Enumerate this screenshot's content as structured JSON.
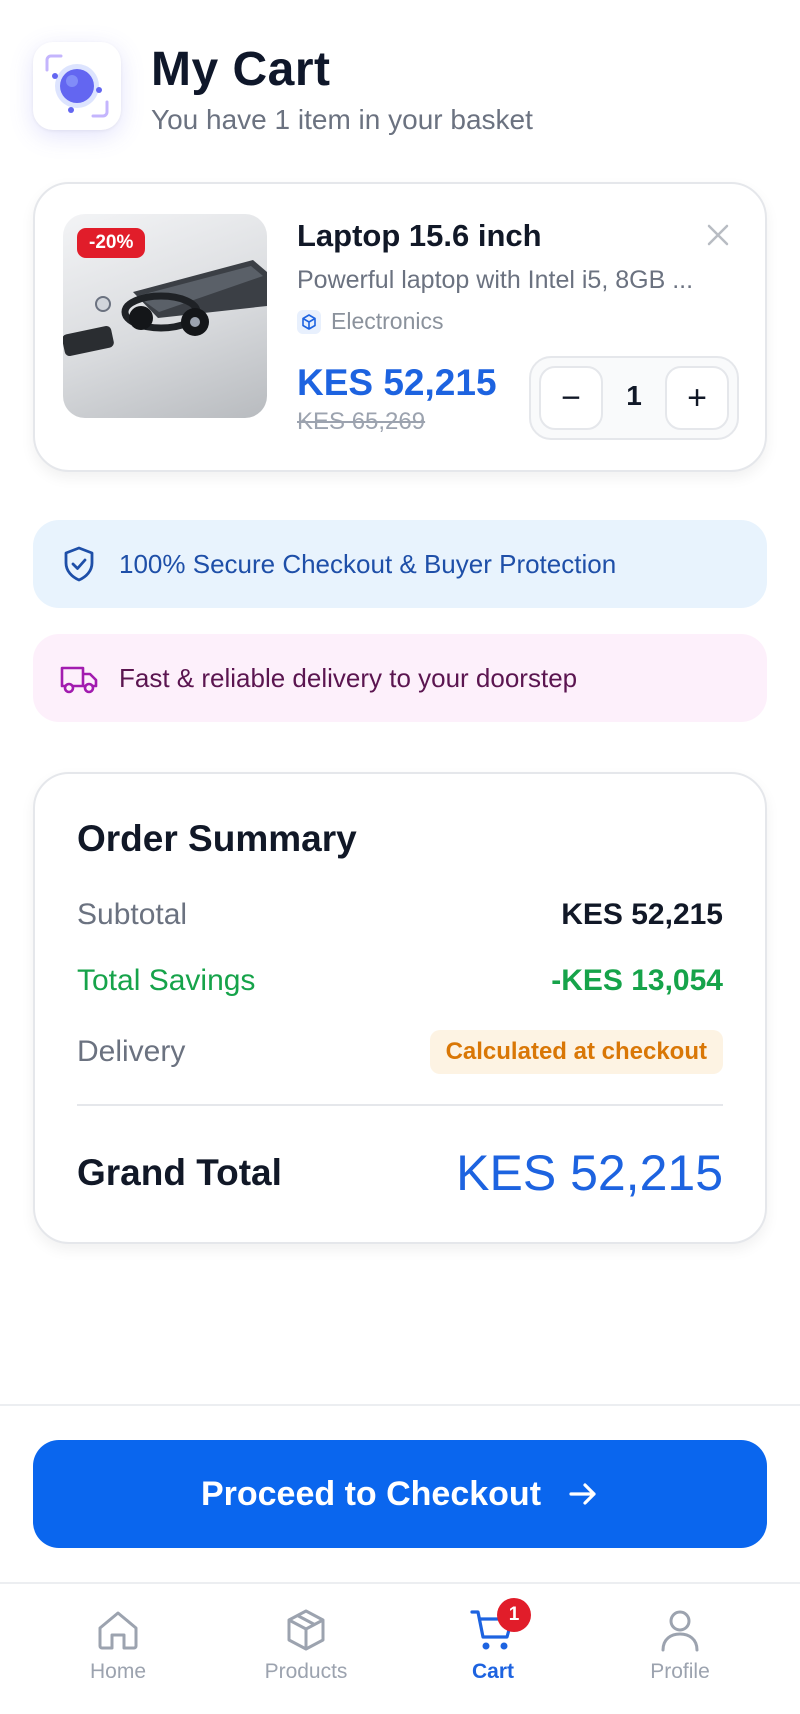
{
  "header": {
    "title": "My Cart",
    "subtitle": "You have 1 item in your basket"
  },
  "cart_item": {
    "discount_badge": "-20%",
    "name": "Laptop 15.6 inch",
    "description": "Powerful laptop with Intel i5, 8GB ...",
    "category": "Electronics",
    "price": "KES 52,215",
    "old_price": "KES 65,269",
    "quantity": "1",
    "minus_symbol": "−",
    "plus_symbol": "+"
  },
  "banners": {
    "secure": "100% Secure Checkout & Buyer Protection",
    "delivery": "Fast & reliable delivery to your doorstep"
  },
  "summary": {
    "title": "Order Summary",
    "subtotal_label": "Subtotal",
    "subtotal_value": "KES 52,215",
    "savings_label": "Total Savings",
    "savings_value": "-KES 13,054",
    "delivery_label": "Delivery",
    "delivery_value": "Calculated at checkout",
    "grand_total_label": "Grand Total",
    "grand_total_value": "KES 52,215"
  },
  "checkout_button": {
    "label": "Proceed to Checkout",
    "icon": "arrow-right-icon"
  },
  "tabbar": {
    "items": [
      {
        "label": "Home",
        "icon": "home-icon"
      },
      {
        "label": "Products",
        "icon": "box-icon"
      },
      {
        "label": "Cart",
        "icon": "cart-icon",
        "badge": "1",
        "active": true
      },
      {
        "label": "Profile",
        "icon": "user-icon"
      }
    ]
  },
  "colors": {
    "accent": "#0a66ee",
    "price": "#1d63e0",
    "discount": "#e11d2a",
    "savings": "#16a34a",
    "delivery_badge": "#d97706"
  }
}
